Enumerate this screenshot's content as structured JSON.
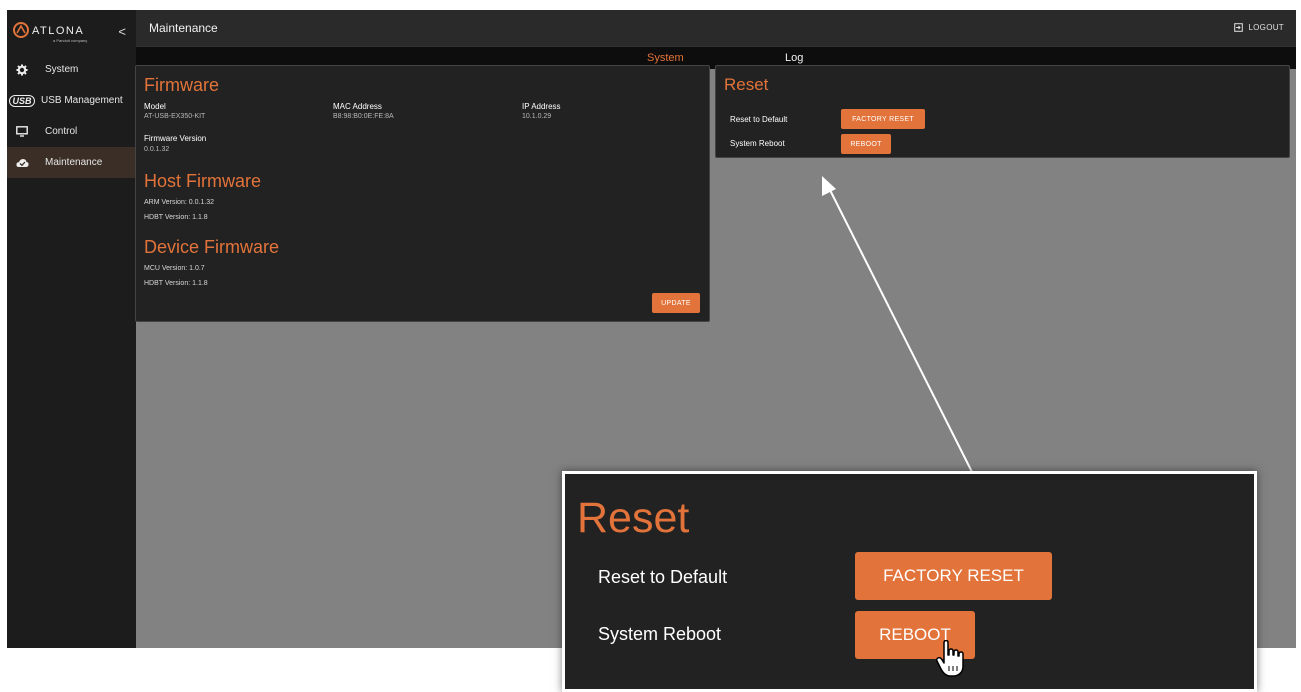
{
  "brand": {
    "name": "ATLONA",
    "sub": "a Panduit company",
    "collapse": "<"
  },
  "sidebar": {
    "items": [
      {
        "label": "System",
        "icon": "gear-icon"
      },
      {
        "label": "USB Management",
        "icon": "usb-icon",
        "icon_text": "USB"
      },
      {
        "label": "Control",
        "icon": "monitor-icon"
      },
      {
        "label": "Maintenance",
        "icon": "cloud-icon",
        "active": true
      }
    ]
  },
  "header": {
    "title": "Maintenance",
    "logout": "LOGOUT"
  },
  "tabs": [
    {
      "label": "System",
      "active": true
    },
    {
      "label": "Log"
    }
  ],
  "firmware": {
    "title": "Firmware",
    "model_label": "Model",
    "model_value": "AT-USB-EX350-KIT",
    "mac_label": "MAC Address",
    "mac_value": "B8:98:B0:0E:FE:8A",
    "ip_label": "IP Address",
    "ip_value": "10.1.0.29",
    "fwver_label": "Firmware Version",
    "fwver_value": "0.0.1.32",
    "host_title": "Host Firmware",
    "host_arm": "ARM Version: 0.0.1.32",
    "host_hdbt": "HDBT Version: 1.1.8",
    "device_title": "Device Firmware",
    "device_mcu": "MCU Version: 1.0.7",
    "device_hdbt": "HDBT Version: 1.1.8",
    "update": "UPDATE"
  },
  "reset": {
    "title": "Reset",
    "default_label": "Reset to Default",
    "factory_btn": "FACTORY RESET",
    "reboot_label": "System Reboot",
    "reboot_btn": "REBOOT"
  },
  "colors": {
    "accent": "#e2733a",
    "panel": "#222222",
    "sidebar": "#1c1c1c",
    "content": "#828282"
  }
}
